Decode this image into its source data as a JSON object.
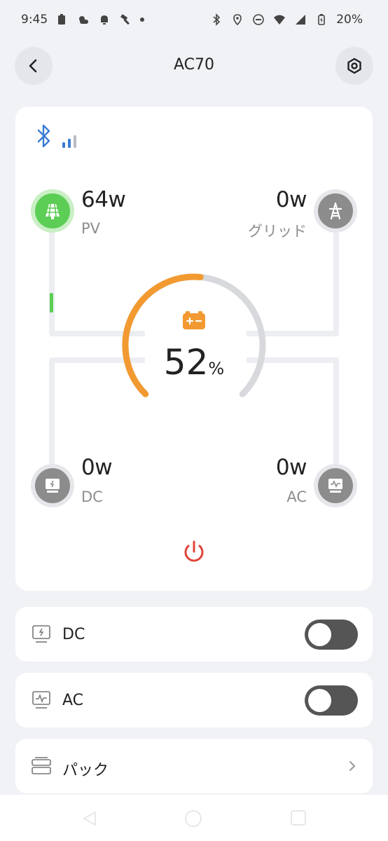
{
  "status_bar": {
    "time": "9:45",
    "battery_percent": "20%"
  },
  "header": {
    "title": "AC70"
  },
  "flow": {
    "pv": {
      "value": "64w",
      "label": "PV"
    },
    "grid": {
      "value": "0w",
      "label": "グリッド"
    },
    "dc": {
      "value": "0w",
      "label": "DC"
    },
    "ac": {
      "value": "0w",
      "label": "AC"
    }
  },
  "battery": {
    "percent_value": "52",
    "percent_unit": "%",
    "level": 0.52
  },
  "outputs": [
    {
      "label": "DC",
      "enabled": false
    },
    {
      "label": "AC",
      "enabled": false
    }
  ],
  "pack_row": {
    "label": "パック"
  },
  "colors": {
    "accent_orange": "#f29a31",
    "pv_green": "#5ccd55",
    "bluetooth_blue": "#3a7bd5",
    "power_red": "#e0443a",
    "toggle_off": "#555555"
  }
}
